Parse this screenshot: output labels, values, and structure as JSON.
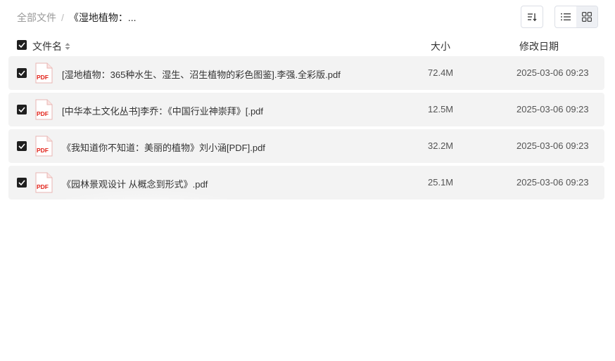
{
  "breadcrumb": {
    "root": "全部文件",
    "separator": "/",
    "current": "《湿地植物：..."
  },
  "toolbar": {
    "sort_icon": "sort-descending-icon",
    "list_view_icon": "list-view-icon",
    "grid_view_icon": "grid-view-icon"
  },
  "table": {
    "columns": {
      "name": "文件名",
      "size": "大小",
      "date": "修改日期"
    },
    "rows": [
      {
        "name": "[湿地植物：365种水生、湿生、沼生植物的彩色图鉴].李强.全彩版.pdf",
        "size": "72.4M",
        "date": "2025-03-06 09:23",
        "type_icon": "pdf-file-icon"
      },
      {
        "name": "[中华本土文化丛书]李乔：《中国行业神崇拜》[.pdf",
        "size": "12.5M",
        "date": "2025-03-06 09:23",
        "type_icon": "pdf-file-icon"
      },
      {
        "name": "《我知道你不知道：美丽的植物》刘小涵[PDF].pdf",
        "size": "32.2M",
        "date": "2025-03-06 09:23",
        "type_icon": "pdf-file-icon"
      },
      {
        "name": "《园林景观设计 从概念到形式》.pdf",
        "size": "25.1M",
        "date": "2025-03-06 09:23",
        "type_icon": "pdf-file-icon"
      }
    ]
  },
  "pdf_label": "PDF",
  "colors": {
    "pdf_red": "#e2231a",
    "row_bg": "#f3f3f3",
    "checkbox": "#1f1f1f"
  }
}
